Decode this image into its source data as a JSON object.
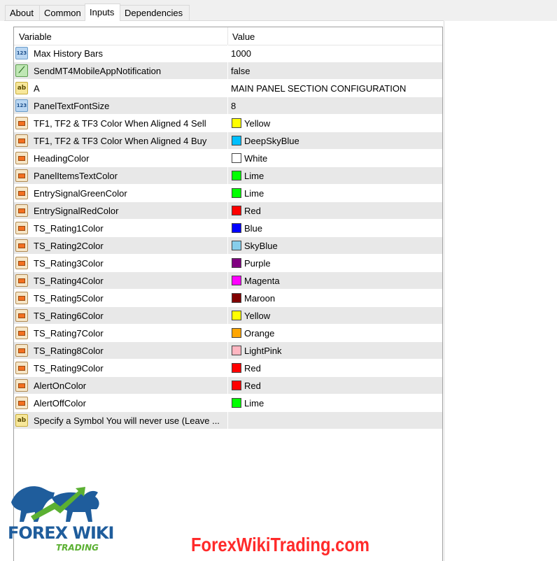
{
  "tabs": [
    {
      "label": "About",
      "active": false
    },
    {
      "label": "Common",
      "active": false
    },
    {
      "label": "Inputs",
      "active": true
    },
    {
      "label": "Dependencies",
      "active": false
    }
  ],
  "grid": {
    "headers": {
      "variable": "Variable",
      "value": "Value"
    },
    "rows": [
      {
        "icon": "number-icon",
        "name": "Max History Bars",
        "value": "1000"
      },
      {
        "icon": "bool-icon",
        "name": "SendMT4MobileAppNotification",
        "value": "false"
      },
      {
        "icon": "string-icon",
        "name": "A",
        "value": "MAIN PANEL SECTION CONFIGURATION"
      },
      {
        "icon": "number-icon",
        "name": "PanelTextFontSize",
        "value": "8"
      },
      {
        "icon": "color-icon",
        "name": "TF1, TF2 & TF3 Color When Aligned 4 Sell",
        "value": "Yellow",
        "color": "#ffff00"
      },
      {
        "icon": "color-icon",
        "name": "TF1, TF2 & TF3 Color When Aligned 4 Buy",
        "value": "DeepSkyBlue",
        "color": "#00bfff"
      },
      {
        "icon": "color-icon",
        "name": "HeadingColor",
        "value": "White",
        "color": "#ffffff"
      },
      {
        "icon": "color-icon",
        "name": "PanelItemsTextColor",
        "value": "Lime",
        "color": "#00ff00"
      },
      {
        "icon": "color-icon",
        "name": "EntrySignalGreenColor",
        "value": "Lime",
        "color": "#00ff00"
      },
      {
        "icon": "color-icon",
        "name": "EntrySignalRedColor",
        "value": "Red",
        "color": "#ff0000"
      },
      {
        "icon": "color-icon",
        "name": "TS_Rating1Color",
        "value": "Blue",
        "color": "#0000ff"
      },
      {
        "icon": "color-icon",
        "name": "TS_Rating2Color",
        "value": "SkyBlue",
        "color": "#87ceeb"
      },
      {
        "icon": "color-icon",
        "name": "TS_Rating3Color",
        "value": "Purple",
        "color": "#800080"
      },
      {
        "icon": "color-icon",
        "name": "TS_Rating4Color",
        "value": "Magenta",
        "color": "#ff00ff"
      },
      {
        "icon": "color-icon",
        "name": "TS_Rating5Color",
        "value": "Maroon",
        "color": "#800000"
      },
      {
        "icon": "color-icon",
        "name": "TS_Rating6Color",
        "value": "Yellow",
        "color": "#ffff00"
      },
      {
        "icon": "color-icon",
        "name": "TS_Rating7Color",
        "value": "Orange",
        "color": "#ffa500"
      },
      {
        "icon": "color-icon",
        "name": "TS_Rating8Color",
        "value": "LightPink",
        "color": "#ffb6c1"
      },
      {
        "icon": "color-icon",
        "name": "TS_Rating9Color",
        "value": "Red",
        "color": "#ff0000"
      },
      {
        "icon": "color-icon",
        "name": "AlertOnColor",
        "value": "Red",
        "color": "#ff0000"
      },
      {
        "icon": "color-icon",
        "name": "AlertOffColor",
        "value": "Lime",
        "color": "#00ff00"
      },
      {
        "icon": "string-icon",
        "name": "Specify a Symbol You will never use (Leave ...",
        "value": ""
      }
    ]
  },
  "branding": {
    "logo_text": "FOREX WIKI",
    "logo_sub": "TRADING",
    "watermark": "ForexWikiTrading.com"
  },
  "icon_glyphs": {
    "number": "123",
    "bool": "⟋",
    "string": "ab"
  }
}
